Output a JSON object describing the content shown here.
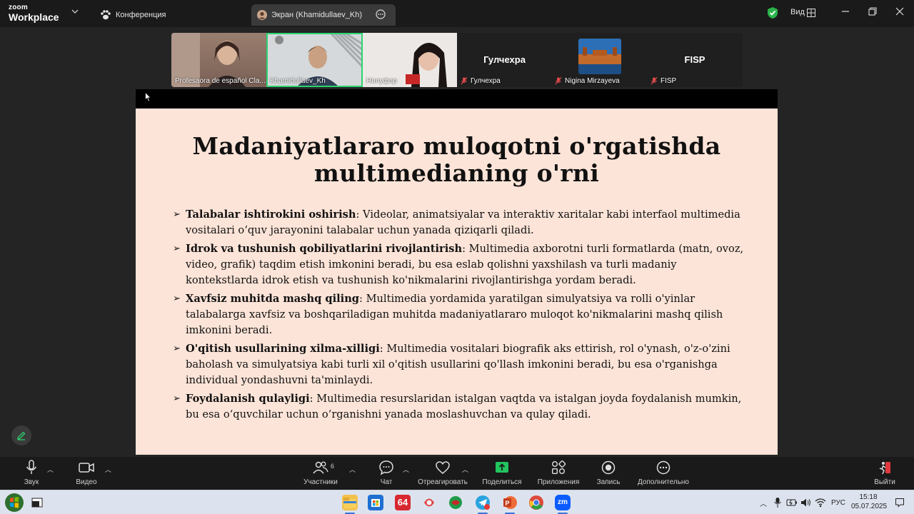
{
  "titlebar": {
    "logo_line1": "zoom",
    "logo_line2": "Workplace",
    "tab_conference": "Конференция",
    "tab_screen": "Экран (Khamidullaev_Kh)",
    "view_label": "Вид"
  },
  "participants": [
    {
      "name": "Profesaora de español Cla..."
    },
    {
      "name": "Khamidullaev_Kh"
    },
    {
      "name": "Нилуфар"
    },
    {
      "display": "Гулчехра",
      "name": "Гулчехра"
    },
    {
      "name": "Nigina Mirzayeva"
    },
    {
      "display": "FISP",
      "name": "FISP"
    }
  ],
  "slide": {
    "title_line1": "Madaniyatlararo muloqotni o'rgatishda",
    "title_line2": "multimedianing o'rni",
    "bullets": [
      {
        "term": "Talabalar ishtirokini oshirish",
        "text": ": Videolar, animatsiyalar va interaktiv xaritalar kabi interfaol multimedia vositalari o‘quv jarayonini talabalar uchun yanada qiziqarli qiladi."
      },
      {
        "term": "Idrok va tushunish qobiliyatlarini rivojlantirish",
        "text": ": Multimedia axborotni turli formatlarda (matn, ovoz, video, grafik) taqdim etish imkonini beradi, bu esa eslab qolishni yaxshilash va turli madaniy kontekstlarda idrok etish va tushunish ko'nikmalarini rivojlantirishga yordam beradi."
      },
      {
        "term": "Xavfsiz muhitda mashq qiling",
        "text": ": Multimedia yordamida yaratilgan simulyatsiya va rolli o'yinlar talabalarga xavfsiz va boshqariladigan muhitda madaniyatlararo muloqot ko'nikmalarini mashq qilish imkonini beradi."
      },
      {
        "term": "O'qitish usullarining xilma-xilligi",
        "text": ": Multimedia vositalari biografik aks ettirish, rol o'ynash, o'z-o'zini baholash va simulyatsiya kabi turli xil o'qitish usullarini qo'llash imkonini beradi, bu esa o'rganishga individual yondashuvni ta'minlaydi."
      },
      {
        "term": "Foydalanish qulayligi",
        "text": ": Multimedia resurslaridan istalgan vaqtda va istalgan joyda foydalanish mumkin, bu esa o‘quvchilar uchun o‘rganishni yanada moslashuvchan va qulay qiladi."
      }
    ]
  },
  "toolbar": {
    "audio": "Звук",
    "video": "Видео",
    "participants": "Участники",
    "participants_count": "6",
    "chat": "Чат",
    "react": "Отреагировать",
    "share": "Поделиться",
    "apps": "Приложения",
    "record": "Запись",
    "more": "Дополнительно",
    "leave": "Выйти"
  },
  "taskbar": {
    "lang": "РУС",
    "time": "15:18",
    "date": "05.07.2025",
    "badge_64": "64"
  },
  "colors": {
    "accent_green": "#2bd46f",
    "slide_bg": "#fde4d8",
    "share_green": "#22c55e"
  }
}
